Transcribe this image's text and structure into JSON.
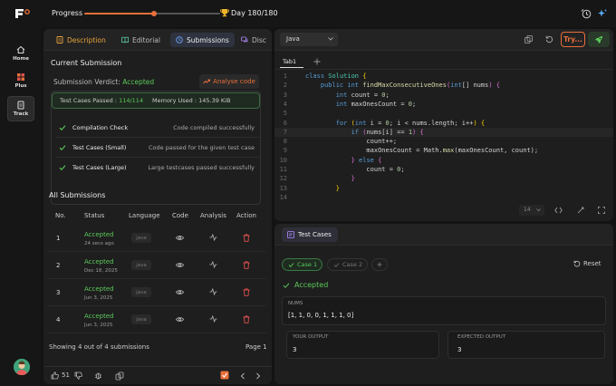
{
  "topbar": {
    "progress_label": "Progress",
    "progress_fraction": 0.51,
    "day_label": "Day 180/180"
  },
  "nav": {
    "items": [
      {
        "label": "Home"
      },
      {
        "label": "Plus"
      },
      {
        "label": "Track"
      }
    ]
  },
  "left": {
    "tabs": [
      "Description",
      "Editorial",
      "Submissions",
      "Disc"
    ],
    "current_title": "Current Submission",
    "verdict_label": "Submission Verdict:",
    "verdict_value": "Accepted",
    "analyse_label": "Analyse code",
    "passed_label": "Test Cases Passed :",
    "passed_value": "114/114",
    "memory_label": "Memory Used : 145.39 KiB",
    "checks": [
      {
        "name": "Compilation Check",
        "desc": "Code compiled successfully"
      },
      {
        "name": "Test Cases (Small)",
        "desc": "Code passed for the given test case"
      },
      {
        "name": "Test Cases (Large)",
        "desc": "Large testcases passed successfully"
      }
    ],
    "all_title": "All Submissions",
    "columns": [
      "No.",
      "Status",
      "Language",
      "Code",
      "Analysis",
      "Action"
    ],
    "rows": [
      {
        "no": "1",
        "status": "Accepted",
        "date": "24 secs ago",
        "lang": "java"
      },
      {
        "no": "2",
        "status": "Accepted",
        "date": "Dec 18, 2025",
        "lang": "java"
      },
      {
        "no": "3",
        "status": "Accepted",
        "date": "Jun 3, 2025",
        "lang": "java"
      },
      {
        "no": "4",
        "status": "Accepted",
        "date": "Jun 3, 2025",
        "lang": "java"
      }
    ],
    "showing": "Showing 4 out of 4 submissions",
    "page": "Page 1",
    "likes": "51"
  },
  "editor": {
    "language": "Java",
    "try_label": "Try...",
    "tab": "Tab1",
    "font_size": "14",
    "code": [
      [
        "1",
        [
          [
            "kw",
            "class "
          ],
          [
            "ty",
            "Solution "
          ],
          [
            "br",
            "{"
          ]
        ]
      ],
      [
        "2",
        [
          [
            "pl",
            "    "
          ],
          [
            "kw",
            "public int "
          ],
          [
            "fn",
            "findMaxConsecutiveOnes"
          ],
          [
            "bp",
            "("
          ],
          [
            "kw",
            "int"
          ],
          [
            "pl",
            "[] nums"
          ],
          [
            "bp",
            ")"
          ],
          [
            "pl",
            " "
          ],
          [
            "bp",
            "{"
          ]
        ]
      ],
      [
        "3",
        [
          [
            "pl",
            "        "
          ],
          [
            "kw",
            "int "
          ],
          [
            "pl",
            "count = "
          ],
          [
            "num",
            "0"
          ],
          [
            "pl",
            ";"
          ]
        ]
      ],
      [
        "4",
        [
          [
            "pl",
            "        "
          ],
          [
            "kw",
            "int "
          ],
          [
            "pl",
            "maxOnesCount = "
          ],
          [
            "num",
            "0"
          ],
          [
            "pl",
            ";"
          ]
        ]
      ],
      [
        "5",
        [
          [
            "pl",
            ""
          ]
        ]
      ],
      [
        "6",
        [
          [
            "pl",
            "        "
          ],
          [
            "kw",
            "for "
          ],
          [
            "br",
            "("
          ],
          [
            "kw",
            "int "
          ],
          [
            "pl",
            "i = "
          ],
          [
            "num",
            "0"
          ],
          [
            "pl",
            "; i < nums.length; i++"
          ],
          [
            "br",
            ")"
          ],
          [
            "pl",
            " "
          ],
          [
            "br",
            "{"
          ]
        ]
      ],
      [
        "7",
        [
          [
            "pl",
            "            "
          ],
          [
            "kw",
            "if "
          ],
          [
            "bp",
            "("
          ],
          [
            "pl",
            "nums[i] == "
          ],
          [
            "num",
            "1"
          ],
          [
            "bp",
            ")"
          ],
          [
            "pl",
            " "
          ],
          [
            "bp",
            "{"
          ]
        ]
      ],
      [
        "8",
        [
          [
            "pl",
            "                count++;"
          ]
        ]
      ],
      [
        "9",
        [
          [
            "pl",
            "                maxOnesCount = Math."
          ],
          [
            "fn",
            "max"
          ],
          [
            "pl",
            "(maxOnesCount, count);"
          ]
        ]
      ],
      [
        "10",
        [
          [
            "pl",
            "            "
          ],
          [
            "bp",
            "}"
          ],
          [
            "kw",
            " else "
          ],
          [
            "bp",
            "{"
          ]
        ]
      ],
      [
        "11",
        [
          [
            "pl",
            "                count = "
          ],
          [
            "num",
            "0"
          ],
          [
            "pl",
            ";"
          ]
        ]
      ],
      [
        "12",
        [
          [
            "pl",
            "            "
          ],
          [
            "bp",
            "}"
          ]
        ]
      ],
      [
        "13",
        [
          [
            "pl",
            "        "
          ],
          [
            "br",
            "}"
          ]
        ]
      ],
      [
        "14",
        [
          [
            "pl",
            ""
          ]
        ]
      ]
    ]
  },
  "tests": {
    "title": "Test Cases",
    "cases": [
      "Case 1",
      "Case 2"
    ],
    "reset": "Reset",
    "result": "Accepted",
    "nums_label": "NUMS",
    "nums_value": "[1, 1, 0, 0, 1, 1, 1, 0]",
    "output_label": "YOUR OUTPUT",
    "output_value": "3",
    "expected_label": "EXPECTED OUTPUT",
    "expected_value": "3"
  }
}
